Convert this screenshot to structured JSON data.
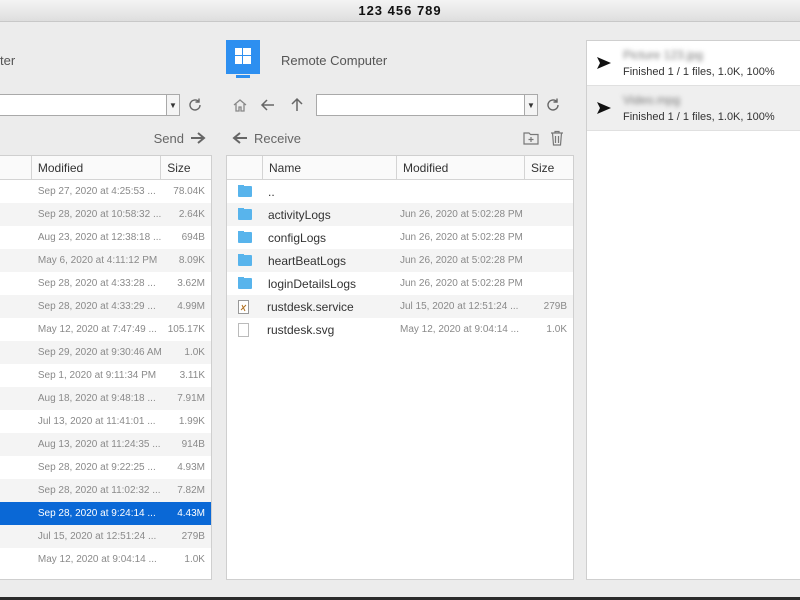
{
  "window": {
    "title": "123 456 789"
  },
  "local": {
    "title_partial": "ter",
    "path_value": "",
    "send_label": "Send",
    "columns": {
      "modified": "Modified",
      "size": "Size"
    },
    "rows": [
      {
        "modified": "Sep 27, 2020 at 4:25:53 ...",
        "size": "78.04K"
      },
      {
        "modified": "Sep 28, 2020 at 10:58:32 ...",
        "size": "2.64K"
      },
      {
        "modified": "Aug 23, 2020 at 12:38:18 ...",
        "size": "694B"
      },
      {
        "modified": "May 6, 2020 at 4:11:12 PM",
        "size": "8.09K"
      },
      {
        "modified": "Sep 28, 2020 at 4:33:28 ...",
        "size": "3.62M"
      },
      {
        "modified": "Sep 28, 2020 at 4:33:29 ...",
        "size": "4.99M"
      },
      {
        "modified": "May 12, 2020 at 7:47:49 ...",
        "size": "105.17K"
      },
      {
        "modified": "Sep 29, 2020 at 9:30:46 AM",
        "size": "1.0K"
      },
      {
        "modified": "Sep 1, 2020 at 9:11:34 PM",
        "size": "3.11K"
      },
      {
        "modified": "Aug 18, 2020 at 9:48:18 ...",
        "size": "7.91M"
      },
      {
        "modified": "Jul 13, 2020 at 11:41:01 ...",
        "size": "1.99K"
      },
      {
        "modified": "Aug 13, 2020 at 11:24:35 ...",
        "size": "914B"
      },
      {
        "modified": "Sep 28, 2020 at 9:22:25 ...",
        "size": "4.93M"
      },
      {
        "modified": "Sep 28, 2020 at 11:02:32 ...",
        "size": "7.82M"
      },
      {
        "modified": "Sep 28, 2020 at 9:24:14 ...",
        "size": "4.43M",
        "selected": true
      },
      {
        "modified": "Jul 15, 2020 at 12:51:24 ...",
        "size": "279B"
      },
      {
        "modified": "May 12, 2020 at 9:04:14 ...",
        "size": "1.0K"
      }
    ]
  },
  "remote": {
    "title": "Remote Computer",
    "path_value": "",
    "receive_label": "Receive",
    "columns": {
      "name": "Name",
      "modified": "Modified",
      "size": "Size"
    },
    "rows": [
      {
        "name": "..",
        "modified": "",
        "size": "",
        "icon": "folder-icon"
      },
      {
        "name": "activityLogs",
        "modified": "Jun 26, 2020 at 5:02:28 PM",
        "size": "",
        "icon": "folder-icon"
      },
      {
        "name": "configLogs",
        "modified": "Jun 26, 2020 at 5:02:28 PM",
        "size": "",
        "icon": "folder-icon"
      },
      {
        "name": "heartBeatLogs",
        "modified": "Jun 26, 2020 at 5:02:28 PM",
        "size": "",
        "icon": "folder-icon"
      },
      {
        "name": "loginDetailsLogs",
        "modified": "Jun 26, 2020 at 5:02:28 PM",
        "size": "",
        "icon": "folder-icon"
      },
      {
        "name": "rustdesk.service",
        "modified": "Jul 15, 2020 at 12:51:24 ...",
        "size": "279B",
        "icon": "script-file-icon"
      },
      {
        "name": "rustdesk.svg",
        "modified": "May 12, 2020 at 9:04:14 ...",
        "size": "1.0K",
        "icon": "file-icon"
      }
    ]
  },
  "jobs": [
    {
      "name": "Picture 123.jpg",
      "status": "Finished 1 / 1 files, 1.0K, 100%"
    },
    {
      "name": "Video.mpg",
      "status": "Finished 1 / 1 files, 1.0K, 100%",
      "active": true
    }
  ],
  "colors": {
    "accent": "#0a68d6",
    "folder": "#58b4ec",
    "windows_blue": "#2d8ff0"
  }
}
